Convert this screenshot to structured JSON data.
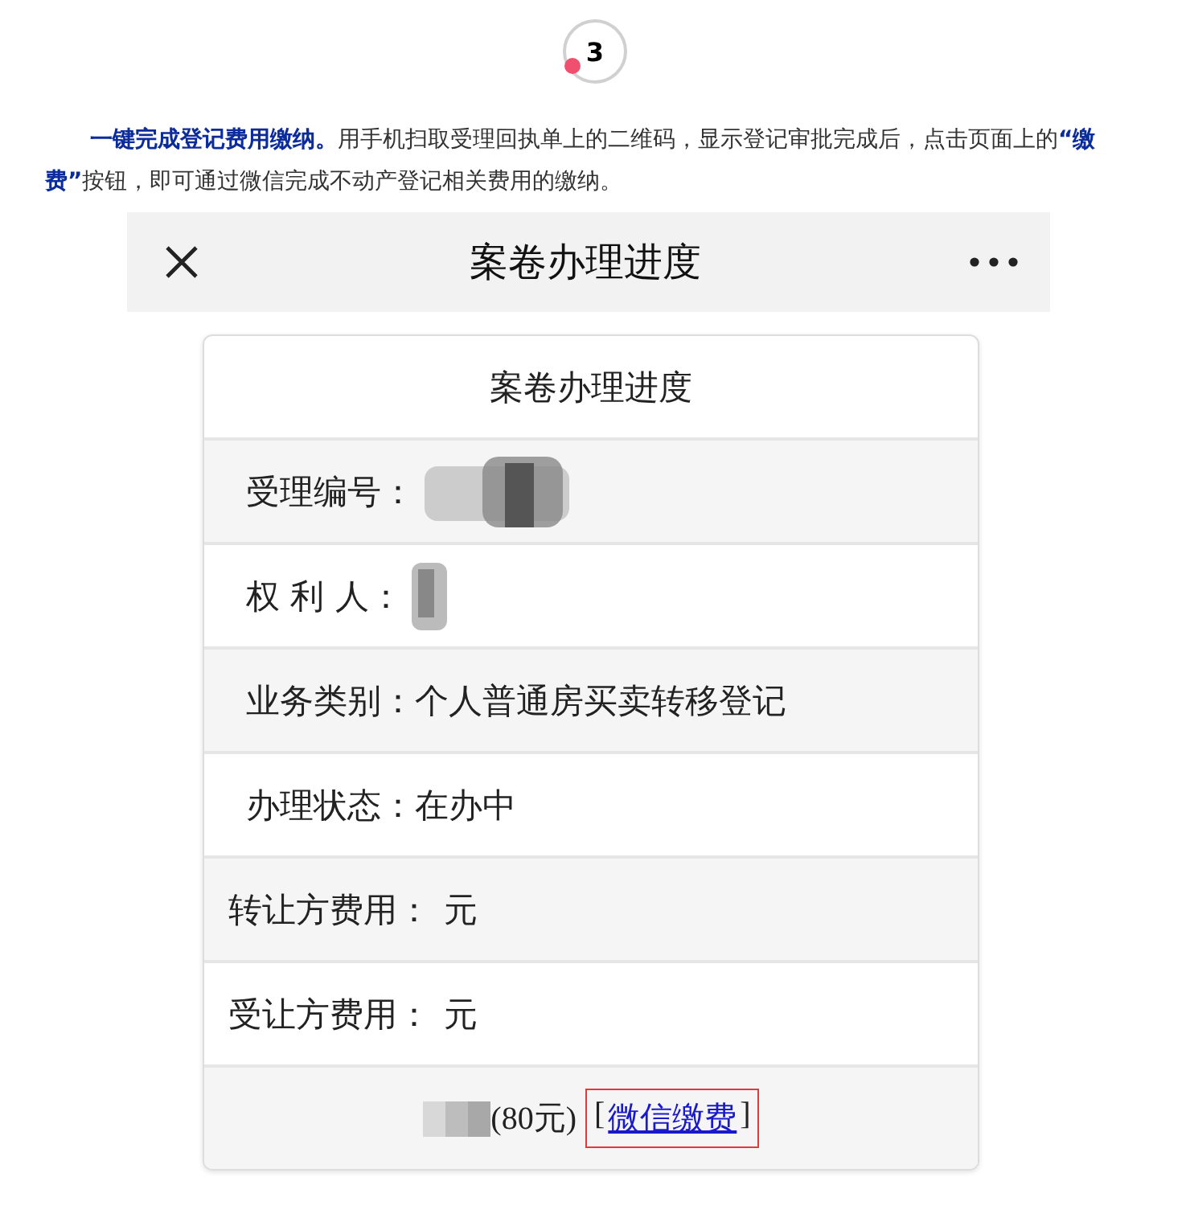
{
  "step": {
    "number": "3"
  },
  "intro": "**一键完成登记费用缴纳。**用手机扫取受理回执单上的二维码，显示登记审批完成后，点击页面上的**“缴费”**按钮，即可通过微信完成不动产登记相关费用的缴纳。",
  "header": {
    "title": "案卷办理进度"
  },
  "card": {
    "title": "案卷办理进度",
    "rows": [
      {
        "kind": "redacted",
        "label": "受理编号："
      },
      {
        "kind": "redacted_short",
        "label": "权 利 人："
      },
      {
        "kind": "field",
        "label": "业务类别：",
        "value": "个人普通房买卖转移登记"
      },
      {
        "kind": "field",
        "label": "办理状态：",
        "value": "在办中"
      },
      {
        "kind": "fee",
        "label": "转让方费用：",
        "value": "元"
      },
      {
        "kind": "fee",
        "label": "受让方费用：",
        "value": "元"
      }
    ],
    "payment": {
      "amount": "(80元)",
      "open_bracket": "[",
      "link": "微信缴费",
      "close_bracket": "]"
    }
  }
}
